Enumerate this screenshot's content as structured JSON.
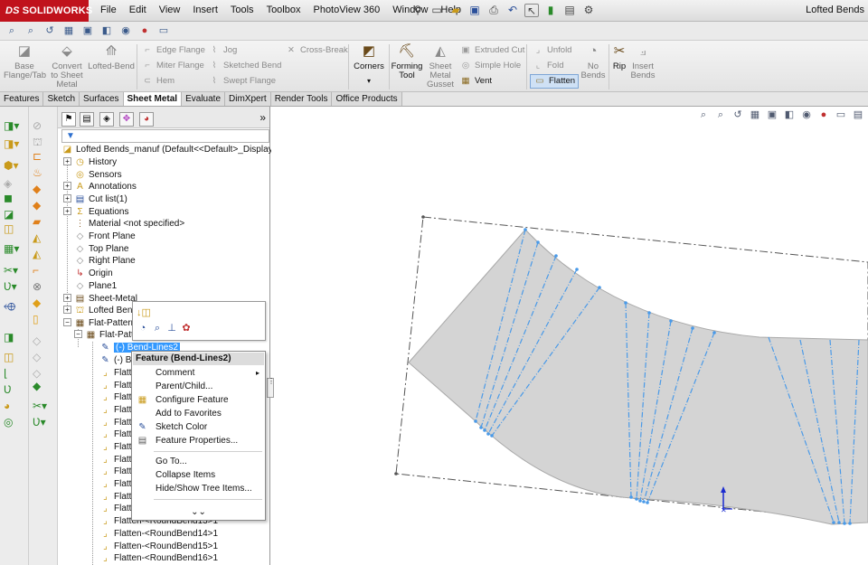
{
  "app": {
    "logo": "SOLIDWORKS",
    "logo_ds": "DS",
    "title_right": "Lofted Bends"
  },
  "menu": [
    "File",
    "Edit",
    "View",
    "Insert",
    "Tools",
    "Toolbox",
    "PhotoView 360",
    "Window",
    "Help"
  ],
  "ribbon": {
    "big_buttons": [
      {
        "label": "Base Flange/Tab",
        "active": false
      },
      {
        "label": "Convert to Sheet Metal",
        "active": false
      },
      {
        "label": "Lofted-Bend",
        "active": false
      },
      {
        "label": "Corners",
        "active": true
      },
      {
        "label": "Forming Tool",
        "active": true
      },
      {
        "label": "Sheet Metal Gusset",
        "active": false
      },
      {
        "label": "No Bends",
        "active": false
      },
      {
        "label": "Rip",
        "active": true
      },
      {
        "label": "Insert Bends",
        "active": false
      }
    ],
    "small_buttons": [
      {
        "label": "Edge Flange",
        "active": false
      },
      {
        "label": "Miter Flange",
        "active": false
      },
      {
        "label": "Hem",
        "active": false
      },
      {
        "label": "Jog",
        "active": false
      },
      {
        "label": "Sketched Bend",
        "active": false
      },
      {
        "label": "Swept Flange",
        "active": false
      },
      {
        "label": "Cross-Break",
        "active": false
      },
      {
        "label": "Extruded Cut",
        "active": false
      },
      {
        "label": "Simple Hole",
        "active": false
      },
      {
        "label": "Vent",
        "active": true
      },
      {
        "label": "Unfold",
        "active": false
      },
      {
        "label": "Fold",
        "active": false
      },
      {
        "label": "Flatten",
        "active": true
      }
    ]
  },
  "tabs": [
    {
      "label": "Features",
      "active": false
    },
    {
      "label": "Sketch",
      "active": false
    },
    {
      "label": "Surfaces",
      "active": false
    },
    {
      "label": "Sheet Metal",
      "active": true
    },
    {
      "label": "Evaluate",
      "active": false
    },
    {
      "label": "DimXpert",
      "active": false
    },
    {
      "label": "Render Tools",
      "active": false
    },
    {
      "label": "Office Products",
      "active": false
    }
  ],
  "feature_tree": {
    "root": "Lofted Bends_manuf  (Default<<Default>_Display State",
    "filter_icon": "filter-icon",
    "items": [
      {
        "label": "History",
        "icon": "history-icon",
        "expandable": true
      },
      {
        "label": "Sensors",
        "icon": "sensor-icon",
        "expandable": true
      },
      {
        "label": "Annotations",
        "icon": "annotation-icon",
        "expandable": true
      },
      {
        "label": "Cut list(1)",
        "icon": "cutlist-icon",
        "expandable": true
      },
      {
        "label": "Equations",
        "icon": "equation-icon",
        "expandable": true
      },
      {
        "label": "Material <not specified>",
        "icon": "material-icon",
        "expandable": false
      },
      {
        "label": "Front Plane",
        "icon": "plane-icon",
        "expandable": false
      },
      {
        "label": "Top Plane",
        "icon": "plane-icon",
        "expandable": false
      },
      {
        "label": "Right Plane",
        "icon": "plane-icon",
        "expandable": false
      },
      {
        "label": "Origin",
        "icon": "origin-icon",
        "expandable": false
      },
      {
        "label": "Plane1",
        "icon": "plane-icon",
        "expandable": false
      },
      {
        "label": "Sheet-Metal",
        "icon": "sheetmetal-icon",
        "expandable": true
      },
      {
        "label": "Lofted Bend",
        "icon": "loftedbend-icon",
        "expandable": true
      },
      {
        "label": "Flat-Pattern",
        "icon": "flatpattern-icon",
        "expandable": true
      }
    ],
    "flat_pattern_child": "Flat-Patt",
    "bend_lines": [
      {
        "label": "(-) Bend-Lines2",
        "selected": true
      },
      {
        "label": "(-) B",
        "selected": false
      }
    ],
    "flatten_short": "Flatten",
    "flatten_items": [
      "Flatten-<RoundBend13>1",
      "Flatten-<RoundBend14>1",
      "Flatten-<RoundBend15>1",
      "Flatten-<RoundBend16>1"
    ]
  },
  "context_menu": {
    "header": "Feature (Bend-Lines2)",
    "items": [
      {
        "label": "Comment",
        "icon": "",
        "submenu": true
      },
      {
        "label": "Parent/Child...",
        "icon": "",
        "submenu": false
      },
      {
        "label": "Configure Feature",
        "icon": "configure-icon",
        "submenu": false
      },
      {
        "label": "Add to Favorites",
        "icon": "",
        "submenu": false
      },
      {
        "label": "Sketch Color",
        "icon": "sketch-color-icon",
        "submenu": false
      },
      {
        "label": "Feature Properties...",
        "icon": "properties-icon",
        "submenu": false
      }
    ],
    "items2": [
      {
        "label": "Go To..."
      },
      {
        "label": "Collapse Items"
      },
      {
        "label": "Hide/Show Tree Items..."
      }
    ],
    "more": "more-chevron-icon"
  },
  "colors": {
    "accent": "#3399ff",
    "bend_line": "#4a9ae8",
    "sheet_fill": "#d4d4d4",
    "logo_bg": "#c0121c"
  }
}
